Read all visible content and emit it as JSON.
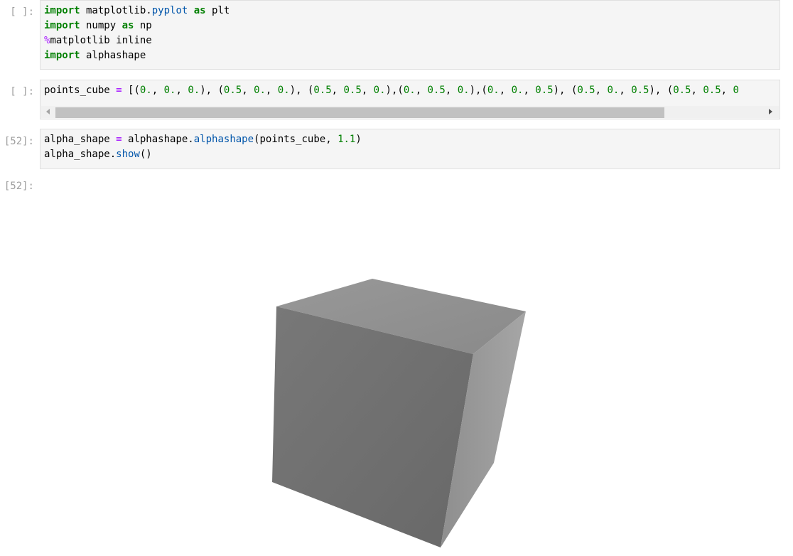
{
  "cells": [
    {
      "prompt": "[ ]:",
      "lines": [
        [
          {
            "t": "import",
            "c": "kw"
          },
          {
            "t": " matplotlib.",
            "c": "plain"
          },
          {
            "t": "pyplot",
            "c": "mod-attr"
          },
          {
            "t": " ",
            "c": "plain"
          },
          {
            "t": "as",
            "c": "kw"
          },
          {
            "t": " plt",
            "c": "plain"
          }
        ],
        [
          {
            "t": "import",
            "c": "kw"
          },
          {
            "t": " numpy ",
            "c": "plain"
          },
          {
            "t": "as",
            "c": "kw"
          },
          {
            "t": " np",
            "c": "plain"
          }
        ],
        [
          {
            "t": "%",
            "c": "magic"
          },
          {
            "t": "matplotlib inline",
            "c": "plain"
          }
        ],
        [
          {
            "t": "import",
            "c": "kw"
          },
          {
            "t": " alphashape",
            "c": "plain"
          }
        ]
      ]
    },
    {
      "prompt": "[ ]:",
      "lines": [
        [
          {
            "t": "points_cube ",
            "c": "plain"
          },
          {
            "t": "=",
            "c": "op"
          },
          {
            "t": " [(",
            "c": "plain"
          },
          {
            "t": "0.",
            "c": "num"
          },
          {
            "t": ", ",
            "c": "plain"
          },
          {
            "t": "0.",
            "c": "num"
          },
          {
            "t": ", ",
            "c": "plain"
          },
          {
            "t": "0.",
            "c": "num"
          },
          {
            "t": "), (",
            "c": "plain"
          },
          {
            "t": "0.5",
            "c": "num"
          },
          {
            "t": ", ",
            "c": "plain"
          },
          {
            "t": "0.",
            "c": "num"
          },
          {
            "t": ", ",
            "c": "plain"
          },
          {
            "t": "0.",
            "c": "num"
          },
          {
            "t": "), (",
            "c": "plain"
          },
          {
            "t": "0.5",
            "c": "num"
          },
          {
            "t": ", ",
            "c": "plain"
          },
          {
            "t": "0.5",
            "c": "num"
          },
          {
            "t": ", ",
            "c": "plain"
          },
          {
            "t": "0.",
            "c": "num"
          },
          {
            "t": "),(",
            "c": "plain"
          },
          {
            "t": "0.",
            "c": "num"
          },
          {
            "t": ", ",
            "c": "plain"
          },
          {
            "t": "0.5",
            "c": "num"
          },
          {
            "t": ", ",
            "c": "plain"
          },
          {
            "t": "0.",
            "c": "num"
          },
          {
            "t": "),(",
            "c": "plain"
          },
          {
            "t": "0.",
            "c": "num"
          },
          {
            "t": ", ",
            "c": "plain"
          },
          {
            "t": "0.",
            "c": "num"
          },
          {
            "t": ", ",
            "c": "plain"
          },
          {
            "t": "0.5",
            "c": "num"
          },
          {
            "t": "), (",
            "c": "plain"
          },
          {
            "t": "0.5",
            "c": "num"
          },
          {
            "t": ", ",
            "c": "plain"
          },
          {
            "t": "0.",
            "c": "num"
          },
          {
            "t": ", ",
            "c": "plain"
          },
          {
            "t": "0.5",
            "c": "num"
          },
          {
            "t": "), (",
            "c": "plain"
          },
          {
            "t": "0.5",
            "c": "num"
          },
          {
            "t": ", ",
            "c": "plain"
          },
          {
            "t": "0.5",
            "c": "num"
          },
          {
            "t": ", ",
            "c": "plain"
          },
          {
            "t": "0",
            "c": "num"
          }
        ]
      ],
      "has_scrollbar": true
    },
    {
      "prompt": "[52]:",
      "lines": [
        [
          {
            "t": "alpha_shape ",
            "c": "plain"
          },
          {
            "t": "=",
            "c": "op"
          },
          {
            "t": " alphashape.",
            "c": "plain"
          },
          {
            "t": "alphashape",
            "c": "mod-attr"
          },
          {
            "t": "(points_cube, ",
            "c": "plain"
          },
          {
            "t": "1.1",
            "c": "num"
          },
          {
            "t": ")",
            "c": "plain"
          }
        ],
        [
          {
            "t": "alpha_shape.",
            "c": "plain"
          },
          {
            "t": "show",
            "c": "mod-attr"
          },
          {
            "t": "()",
            "c": "plain"
          }
        ]
      ]
    }
  ],
  "output": {
    "prompt": "[52]:",
    "figure": "cube-render"
  },
  "colors": {
    "cell_background": "#f5f5f5",
    "cell_border": "#e0e0e0",
    "prompt": "#9e9e9e",
    "keyword": "#008000",
    "number": "#008000",
    "operator": "#aa22ff",
    "attribute": "#0055aa",
    "cube_top": "#8f8f8f",
    "cube_front": "#6f6f6f",
    "cube_side": "#999999"
  }
}
